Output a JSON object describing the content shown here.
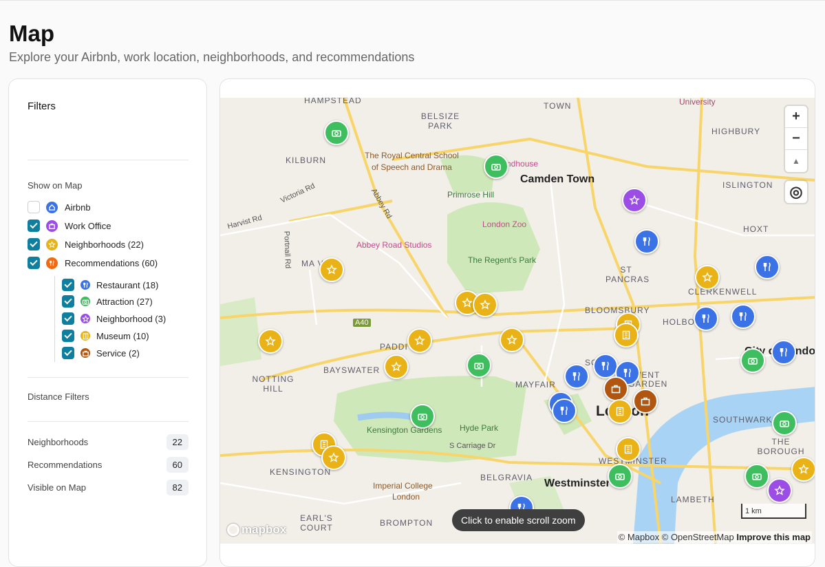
{
  "header": {
    "title": "Map",
    "subtitle": "Explore your Airbnb, work location, neighborhoods, and recommendations"
  },
  "filters": {
    "title": "Filters",
    "show_on_map_label": "Show on Map",
    "items": [
      {
        "label": "Airbnb",
        "checked": false,
        "icon": "home-icon",
        "color": "#3b73e6"
      },
      {
        "label": "Work Office",
        "checked": true,
        "icon": "briefcase-icon",
        "color": "#9b4de6"
      },
      {
        "label": "Neighborhoods (22)",
        "checked": true,
        "icon": "star-icon",
        "color": "#e9b216"
      },
      {
        "label": "Recommendations (60)",
        "checked": true,
        "icon": "fork-knife-icon",
        "color": "#f06a14"
      }
    ],
    "sub_items": [
      {
        "label": "Restaurant (18)",
        "checked": true,
        "icon": "fork-knife-icon",
        "color": "#3b73e6"
      },
      {
        "label": "Attraction (27)",
        "checked": true,
        "icon": "camera-icon",
        "color": "#3fbe5f"
      },
      {
        "label": "Neighborhood (3)",
        "checked": true,
        "icon": "star-icon",
        "color": "#9b4de6"
      },
      {
        "label": "Museum (10)",
        "checked": true,
        "icon": "building-icon",
        "color": "#e9b216"
      },
      {
        "label": "Service (2)",
        "checked": true,
        "icon": "briefcase-icon",
        "color": "#b15610"
      }
    ],
    "distance_filters_label": "Distance Filters",
    "stats": [
      {
        "label": "Neighborhoods",
        "value": "22"
      },
      {
        "label": "Recommendations",
        "value": "60"
      },
      {
        "label": "Visible on Map",
        "value": "82"
      }
    ]
  },
  "map": {
    "labels": {
      "hampstead": "HAMPSTEAD",
      "belsize_park": "BELSIZE\nPARK",
      "kentish_town": "TOWN",
      "highbury": "HIGHBURY",
      "university": "University",
      "kilburn": "KILBURN",
      "camden_town": "Camden Town",
      "islington": "ISLINGTON",
      "royal_central": "The Royal Central School",
      "royal_central_2": "of Speech and Drama",
      "roundhouse": "ndhouse",
      "primrose_hill": "Primrose Hill",
      "london_zoo": "London Zoo",
      "abbey_road_studios": "Abbey Road Studios",
      "regents_park": "The Regent's Park",
      "maida_vale": "MA      VALE",
      "st_pancras": "ST\nPANCRAS",
      "clerkenwell": "CLERKENWELL",
      "bloomsbury": "BLOOMSBURY",
      "holborn": "HOLBO",
      "city_of_london": "City of Londo",
      "paddington": "PADDI   ON",
      "bayswater": "BAYSWATER",
      "notting_hill": "NOTTING\nHILL",
      "mayfair": "MAYFAIR",
      "soho": "SOH",
      "covent_garden": "OVENT\nGARDEN",
      "london": "London",
      "southwark": "SOUTHWARK",
      "kensington_gardens": "Kensington Gardens",
      "hyde_park": "Hyde Park",
      "s_carriage": "S Carriage Dr",
      "the_borough": "THE\nBOROUGH",
      "westminster_area": "WESTMINSTER",
      "kensington": "KENSINGTON",
      "belgravia": "BELGRAVIA",
      "imperial": "Imperial College",
      "imperial_2": "London",
      "westminster": "Westminster",
      "lambeth": "LAMBETH",
      "earls_court": "EARL'S\nCOURT",
      "brompton": "BROMPTON",
      "hoxton": "HOXT",
      "road_victoria": "Victoria Rd",
      "road_harvist": "Harvist Rd",
      "road_portnall": "Portnall Rd",
      "road_abbey": "Abbey Rd",
      "road_a40": "A40"
    },
    "scroll_zoom_hint": "Click to enable scroll zoom",
    "scale_label": "1 km",
    "attribution": "© Mapbox © OpenStreetMap",
    "improve_link": "Improve this map",
    "mapbox_brand": "mapbox",
    "zoom_in": "+",
    "zoom_out": "−",
    "compass": "▲",
    "locate": "◎"
  }
}
